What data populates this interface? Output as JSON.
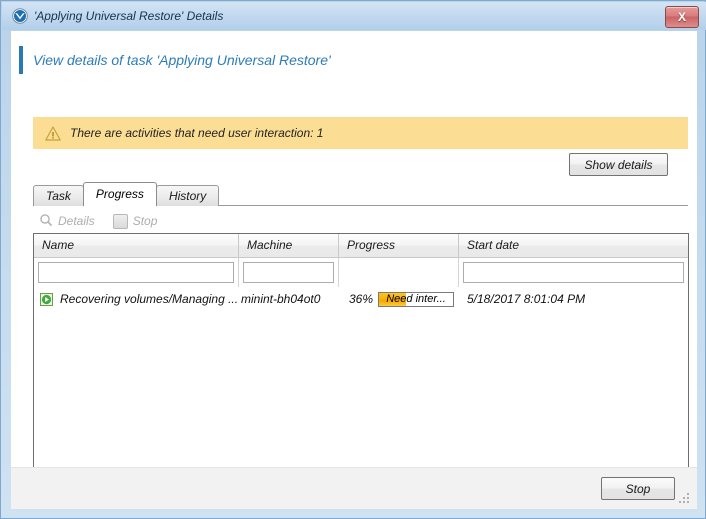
{
  "window": {
    "title": "'Applying Universal Restore' Details",
    "title_icon": "acronis-shield-icon",
    "close_label": "X"
  },
  "header": {
    "title": "View details of task 'Applying Universal Restore'",
    "accent_color": "#2879b4"
  },
  "warning": {
    "icon": "warning-triangle-icon",
    "text": "There are activities that need user interaction: 1",
    "background_color": "#fbdd94"
  },
  "actions": {
    "show_details_label": "Show details",
    "stop_label": "Stop"
  },
  "tabs": [
    {
      "label": "Task",
      "active": false
    },
    {
      "label": "Progress",
      "active": true
    },
    {
      "label": "History",
      "active": false
    }
  ],
  "toolbar": [
    {
      "label": "Details",
      "icon": "magnifier-icon",
      "enabled": false
    },
    {
      "label": "Stop",
      "icon": "stop-square-icon",
      "enabled": false
    }
  ],
  "grid": {
    "columns": [
      {
        "label": "Name",
        "filter_value": "",
        "has_filter": true
      },
      {
        "label": "Machine",
        "filter_value": "",
        "has_filter": true
      },
      {
        "label": "Progress",
        "filter_value": "",
        "has_filter": false
      },
      {
        "label": "Start date",
        "filter_value": "",
        "has_filter": true
      }
    ],
    "rows": [
      {
        "status_icon": "running-green-icon",
        "name": "Recovering volumes/Managing ...",
        "machine": "minint-bh04ot0",
        "progress_percent": "36%",
        "progress_value": 36,
        "progress_label": "Need inter...",
        "progress_color": "#f5a800",
        "start_date": "5/18/2017 8:01:04 PM"
      }
    ]
  }
}
